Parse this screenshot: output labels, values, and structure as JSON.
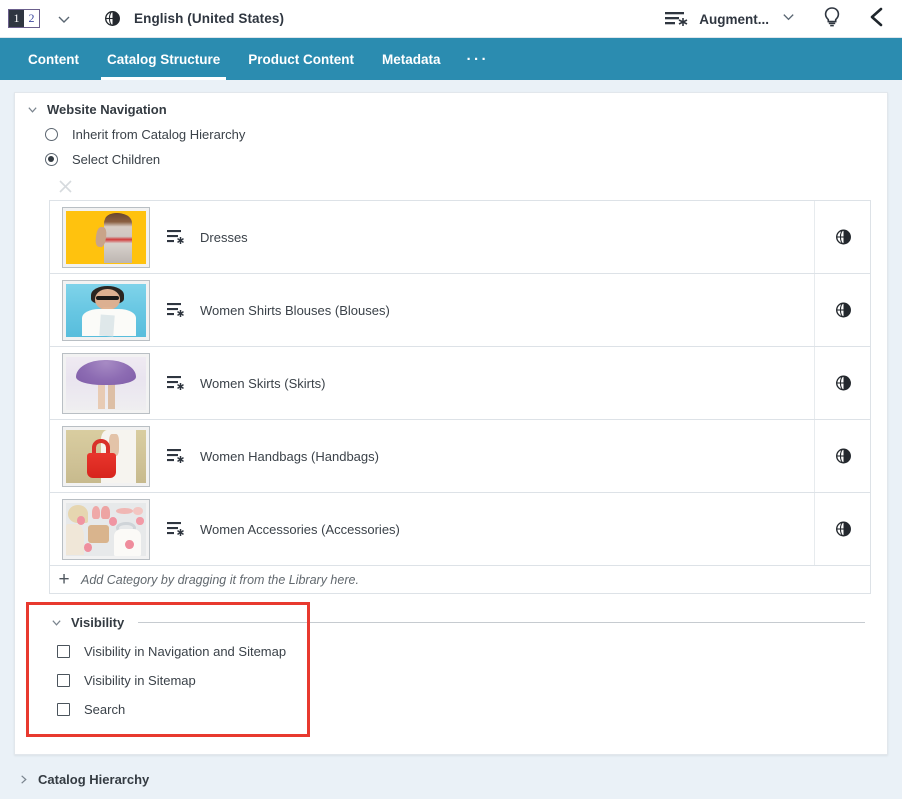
{
  "topbar": {
    "pager": {
      "current": "1",
      "next": "2"
    },
    "dropdown_caret_icon": "chevron-down-icon",
    "language_icon": "globe-icon",
    "language": "English (United States)",
    "augment_icon": "augment-icon",
    "augment_label": "Augment...",
    "augment_caret_icon": "chevron-down-icon",
    "tips_icon": "lightbulb-icon",
    "collapse_icon": "chevron-left-icon"
  },
  "tabs": [
    {
      "label": "Content",
      "active": false
    },
    {
      "label": "Catalog Structure",
      "active": true
    },
    {
      "label": "Product Content",
      "active": false
    },
    {
      "label": "Metadata",
      "active": false
    },
    {
      "label": "···",
      "active": false
    }
  ],
  "website_navigation": {
    "title": "Website Navigation",
    "caret_icon": "chevron-down-icon",
    "clear_icon": "close-x-icon",
    "radio_options": [
      {
        "label": "Inherit from Catalog Hierarchy",
        "checked": false
      },
      {
        "label": "Select Children",
        "checked": true
      }
    ],
    "rows": [
      {
        "label": "Dresses",
        "icon": "category-list-icon",
        "globe_icon": "globe-icon",
        "thumb": "t-dress"
      },
      {
        "label": "Women Shirts Blouses (Blouses)",
        "icon": "category-list-icon",
        "globe_icon": "globe-icon",
        "thumb": "t-blouse"
      },
      {
        "label": "Women Skirts (Skirts)",
        "icon": "category-list-icon",
        "globe_icon": "globe-icon",
        "thumb": "t-skirt"
      },
      {
        "label": "Women Handbags (Handbags)",
        "icon": "category-list-icon",
        "globe_icon": "globe-icon",
        "thumb": "t-bag"
      },
      {
        "label": "Women Accessories (Accessories)",
        "icon": "category-list-icon",
        "globe_icon": "globe-icon",
        "thumb": "t-acc"
      }
    ],
    "add_row": {
      "plus": "+",
      "text": "Add Category by dragging it from the Library here."
    }
  },
  "visibility": {
    "title": "Visibility",
    "caret_icon": "chevron-down-icon",
    "checkboxes": [
      {
        "label": "Visibility in Navigation and Sitemap",
        "checked": false
      },
      {
        "label": "Visibility in Sitemap",
        "checked": false
      },
      {
        "label": "Search",
        "checked": false
      }
    ]
  },
  "catalog_hierarchy": {
    "title": "Catalog Hierarchy",
    "caret_icon": "chevron-right-icon"
  },
  "colors": {
    "tabbar": "#2b8cb0",
    "page_bg": "#eaf1f7",
    "highlight": "#e8392f",
    "text": "#3b4249"
  }
}
